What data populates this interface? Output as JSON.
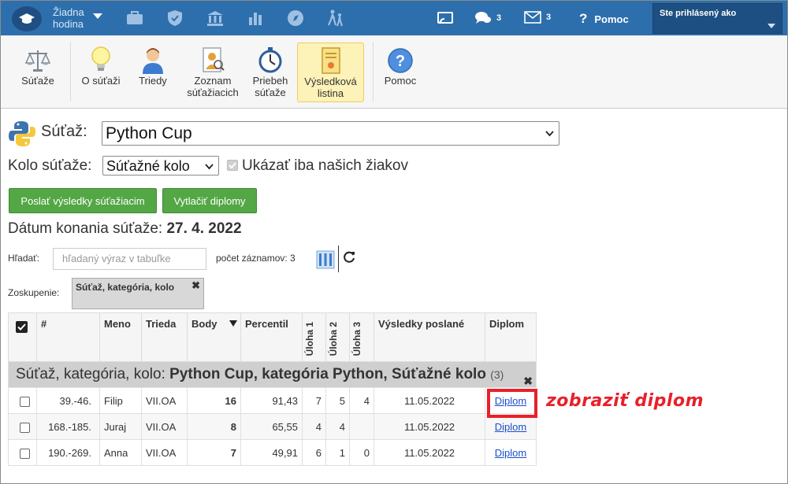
{
  "topnav": {
    "hodina_line1": "Žiadna",
    "hodina_line2": "hodina",
    "messages_count": "3",
    "mail_count": "3",
    "help_label": "Pomoc",
    "login_label": "Ste prihlásený ako"
  },
  "toolbar": {
    "items": [
      {
        "line1": "Súťaže",
        "line2": "",
        "icon": "scales-icon"
      },
      {
        "line1": "O súťaži",
        "line2": "",
        "icon": "lightbulb-icon"
      },
      {
        "line1": "Triedy",
        "line2": "",
        "icon": "student-icon"
      },
      {
        "line1": "Zoznam",
        "line2": "súťažiacich",
        "icon": "contestant-list-icon"
      },
      {
        "line1": "Priebeh",
        "line2": "súťaže",
        "icon": "stopwatch-icon"
      },
      {
        "line1": "Výsledková",
        "line2": "listina",
        "icon": "certificate-icon"
      },
      {
        "line1": "Pomoc",
        "line2": "",
        "icon": "help-icon"
      }
    ]
  },
  "competition": {
    "label": "Súťaž:",
    "value": "Python Cup",
    "round_label": "Kolo súťaže:",
    "round_value": "Súťažné kolo",
    "only_ours_label": "Ukázať iba našich žiakov",
    "send_results_button": "Poslať výsledky súťažiacim",
    "print_diplomas_button": "Vytlačiť diplomy",
    "date_label": "Dátum konania súťaže:",
    "date_value": "27. 4. 2022"
  },
  "filter": {
    "search_label": "Hľadať:",
    "search_placeholder": "hľadaný výraz v tabuľke",
    "records_label": "počet záznamov: 3",
    "grouping_label": "Zoskupenie:",
    "grouping_chip": "Súťaž, kategória, kolo"
  },
  "table": {
    "headers": {
      "num": "#",
      "name": "Meno",
      "class": "Trieda",
      "points": "Body",
      "percentile": "Percentil",
      "task1": "Úloha 1",
      "task2": "Úloha 2",
      "task3": "Úloha 3",
      "results_sent": "Výsledky poslané",
      "diploma": "Diplom"
    },
    "group_label": "Súťaž, kategória, kolo:",
    "group_value": "Python Cup, kategória Python, Súťažné kolo",
    "group_count": "(3)",
    "rows": [
      {
        "rank": "39.-46.",
        "name": "Filip",
        "class": "VII.OA",
        "points": "16",
        "percentile": "91,43",
        "t1": "7",
        "t2": "5",
        "t3": "4",
        "sent": "11.05.2022",
        "diploma": "Diplom"
      },
      {
        "rank": "168.-185.",
        "name": "Juraj",
        "class": "VII.OA",
        "points": "8",
        "percentile": "65,55",
        "t1": "4",
        "t2": "4",
        "t3": "",
        "sent": "11.05.2022",
        "diploma": "Diplom"
      },
      {
        "rank": "190.-269.",
        "name": "Anna",
        "class": "VII.OA",
        "points": "7",
        "percentile": "49,91",
        "t1": "6",
        "t2": "1",
        "t3": "0",
        "sent": "11.05.2022",
        "diploma": "Diplom"
      }
    ]
  },
  "annotation": {
    "text": "zobraziť diplom",
    "color": "#e8202a"
  },
  "colors": {
    "nav_blue": "#2d6fad",
    "green_button": "#53a745",
    "active_tab": "#fdf2b7"
  }
}
